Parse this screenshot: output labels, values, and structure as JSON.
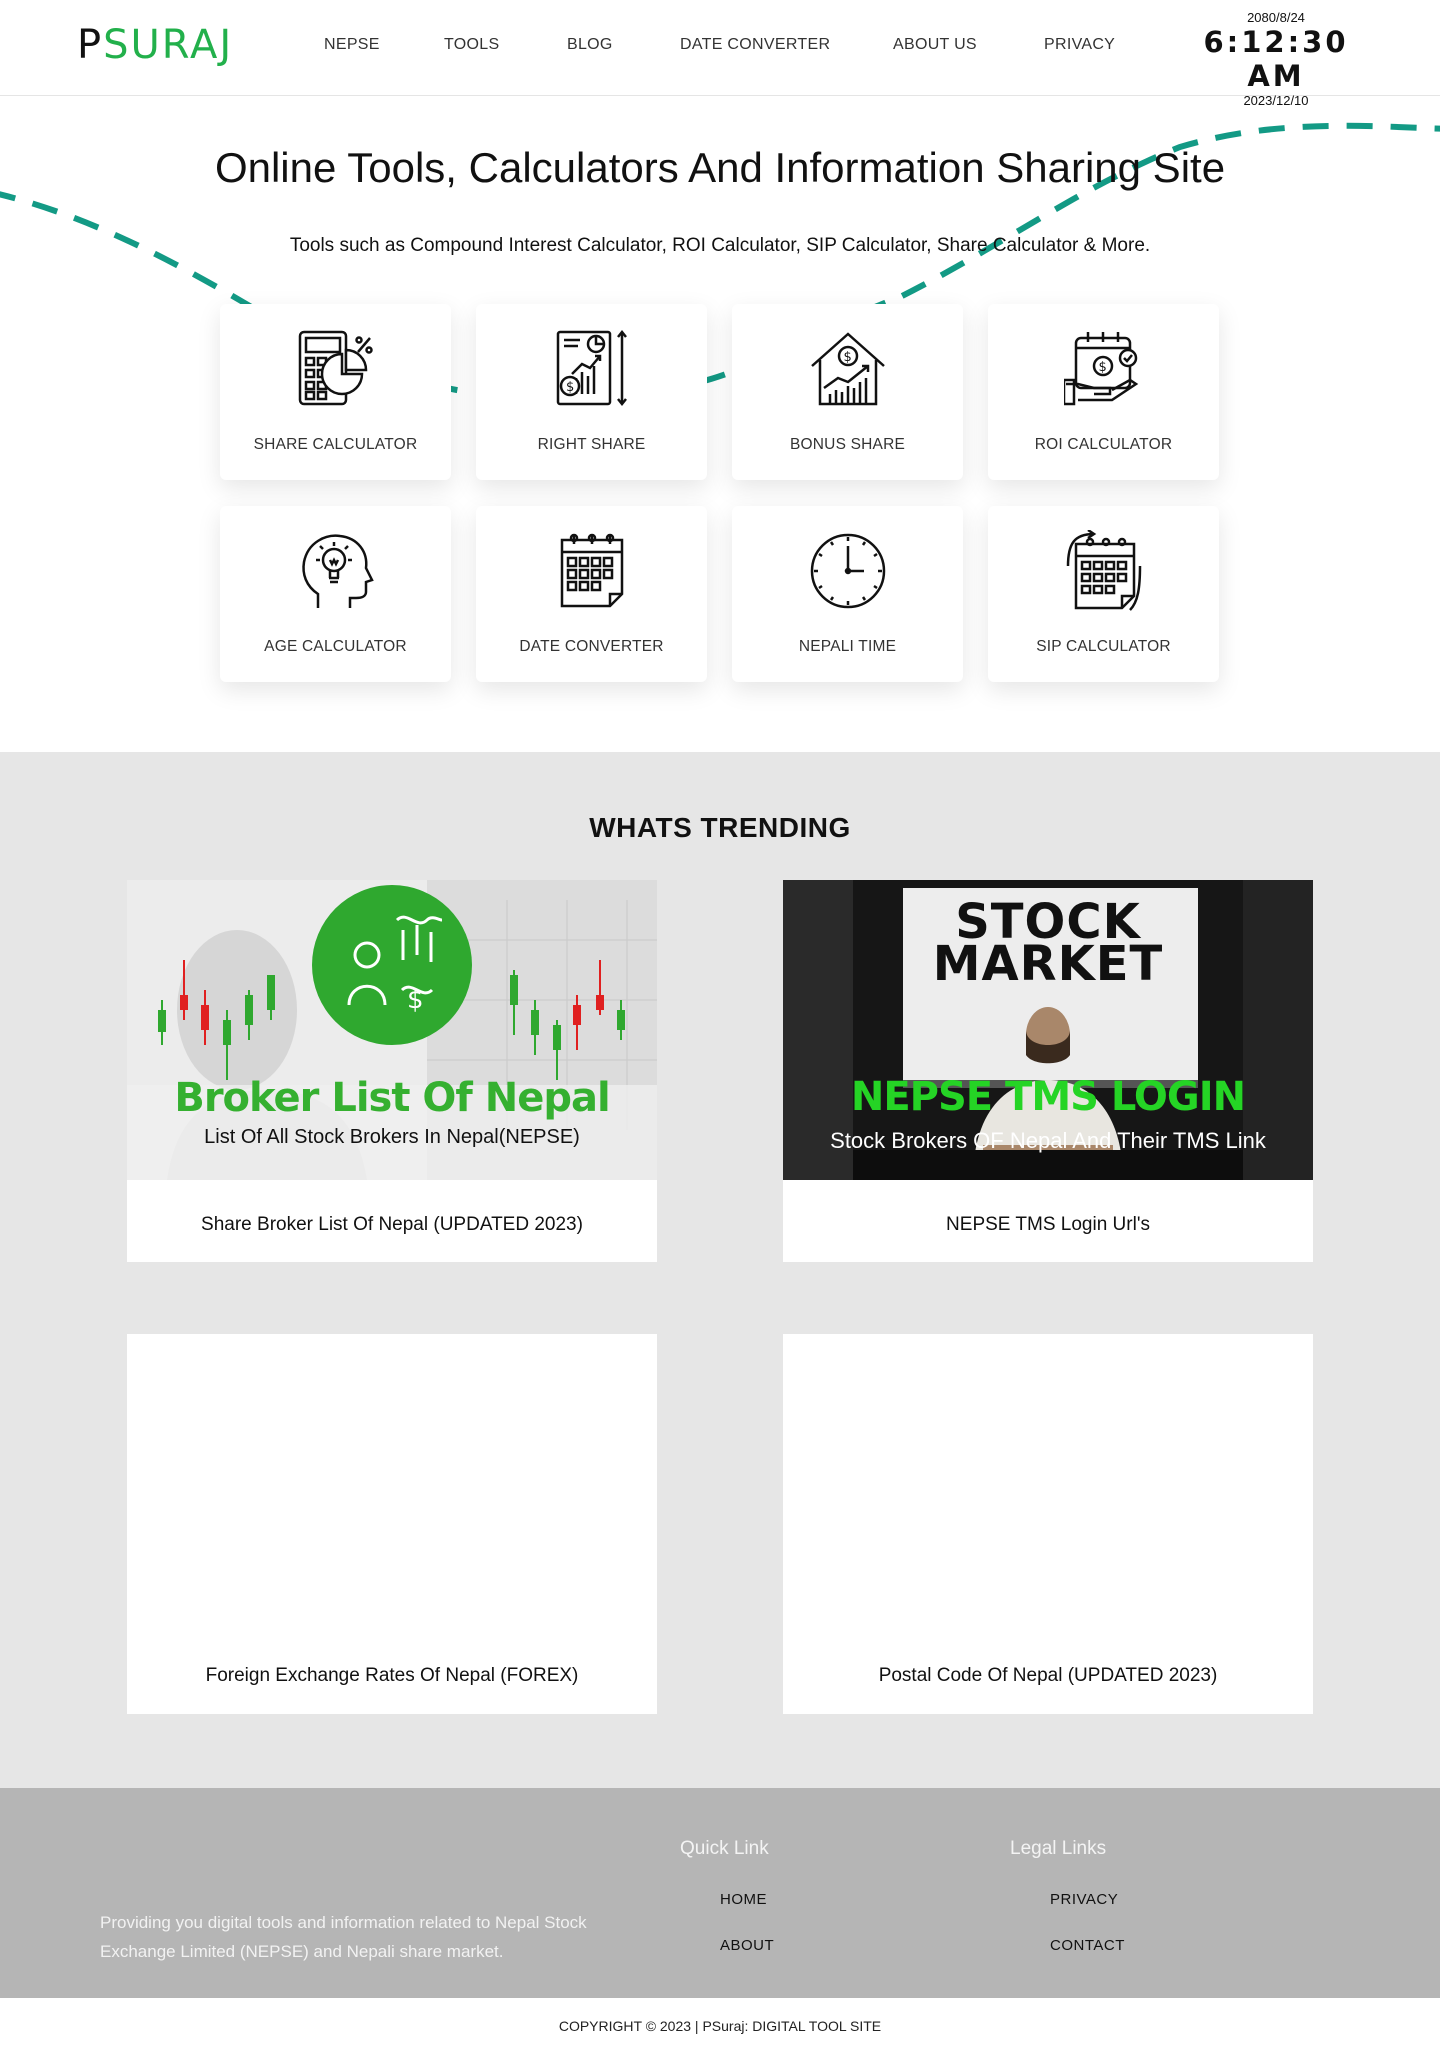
{
  "header": {
    "logo_first": "P",
    "logo_rest": "SURAJ",
    "nav": [
      "NEPSE",
      "TOOLS",
      "BLOG",
      "DATE CONVERTER",
      "ABOUT US",
      "PRIVACY"
    ],
    "clock": {
      "nepali_date": "2080/8/24",
      "time": "6:12:30 AM",
      "english_date": "2023/12/10"
    }
  },
  "hero": {
    "title": "Online Tools, Calculators And Information Sharing Site",
    "subtitle": "Tools such as Compound Interest Calculator, ROI Calculator, SIP Calculator, Share Calculator & More."
  },
  "tools": [
    {
      "label": "SHARE CALCULATOR",
      "icon": "calculator-icon"
    },
    {
      "label": "RIGHT SHARE",
      "icon": "report-chart-icon"
    },
    {
      "label": "BONUS SHARE",
      "icon": "house-growth-icon"
    },
    {
      "label": "ROI CALCULATOR",
      "icon": "calendar-money-hand-icon"
    },
    {
      "label": "AGE CALCULATOR",
      "icon": "head-bulb-icon"
    },
    {
      "label": "DATE CONVERTER",
      "icon": "calendar-icon"
    },
    {
      "label": "NEPALI TIME",
      "icon": "clock-icon"
    },
    {
      "label": "SIP CALCULATOR",
      "icon": "calendar-refresh-icon"
    }
  ],
  "trending": {
    "title": "WHATS TRENDING",
    "posts": [
      {
        "caption": "Share Broker List Of Nepal (UPDATED 2023)",
        "img_title": "Broker List Of Nepal",
        "img_sub": "List Of All Stock Brokers In Nepal(NEPSE)"
      },
      {
        "caption": "NEPSE TMS Login Url's",
        "img_board_line1": "STOCK",
        "img_board_line2": "MARKET",
        "img_title": "NEPSE TMS LOGIN",
        "img_sub": "Stock Brokers OF Nepal And Their TMS Link"
      },
      {
        "caption": "Foreign Exchange Rates Of Nepal (FOREX)"
      },
      {
        "caption": "Postal Code Of Nepal (UPDATED 2023)"
      }
    ]
  },
  "footer": {
    "description": "Providing you digital tools and information related to Nepal Stock Exchange Limited (NEPSE) and Nepali share market.",
    "quick_link_title": "Quick Link",
    "quick_links": [
      "HOME",
      "ABOUT"
    ],
    "legal_title": "Legal Links",
    "legal_links": [
      "PRIVACY",
      "CONTACT"
    ],
    "copyright": "COPYRIGHT © 2023 | PSuraj: DIGITAL TOOL SITE"
  },
  "colors": {
    "brand_green": "#22b04b",
    "dash_teal": "#139a85",
    "trending_bg": "#e6e6e6",
    "footer_bg": "#b5b5b5"
  }
}
